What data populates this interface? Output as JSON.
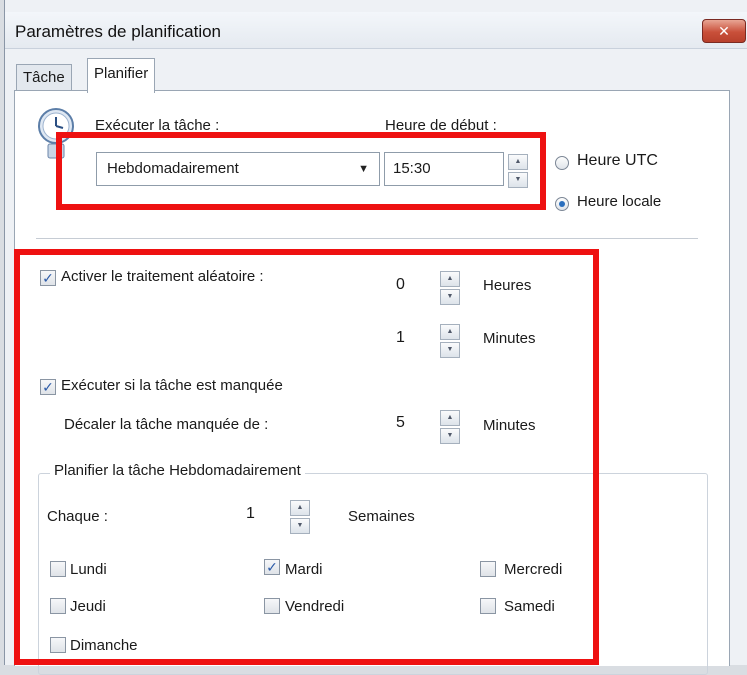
{
  "window": {
    "title": "Paramètres de planification",
    "close_glyph": "✕"
  },
  "tabs": [
    {
      "label": "Tâche",
      "active": false
    },
    {
      "label": "Planifier",
      "active": true
    }
  ],
  "schedule": {
    "run_label": "Exécuter la tâche :",
    "run_value": "Hebdomadairement",
    "start_label": "Heure de début :",
    "start_value": "15:30",
    "timezone_options": [
      {
        "label": "Heure UTC",
        "selected": false
      },
      {
        "label": "Heure locale",
        "selected": true
      }
    ]
  },
  "random": {
    "label": "Activer le traitement aléatoire :",
    "checked": true,
    "hours_value": "0",
    "hours_unit": "Heures",
    "minutes_value": "1",
    "minutes_unit": "Minutes"
  },
  "missed": {
    "label": "Exécuter si la tâche est manquée",
    "checked": true,
    "shift_label": "Décaler la tâche manquée de :",
    "shift_value": "5",
    "shift_unit": "Minutes"
  },
  "weekly": {
    "group_title": "Planifier la tâche Hebdomadairement",
    "every_label": "Chaque :",
    "every_value": "1",
    "every_unit": "Semaines",
    "days": [
      {
        "label": "Lundi",
        "checked": false
      },
      {
        "label": "Mardi",
        "checked": true
      },
      {
        "label": "Mercredi",
        "checked": false
      },
      {
        "label": "Jeudi",
        "checked": false
      },
      {
        "label": "Vendredi",
        "checked": false
      },
      {
        "label": "Samedi",
        "checked": false
      },
      {
        "label": "Dimanche",
        "checked": false
      }
    ]
  },
  "icons": {
    "clock": "clock-icon",
    "dropdown": "chevron-down-icon"
  },
  "colors": {
    "highlight": "#ee1111",
    "radio_selected": "#2a6fbe",
    "check": "#2b5aa8"
  }
}
